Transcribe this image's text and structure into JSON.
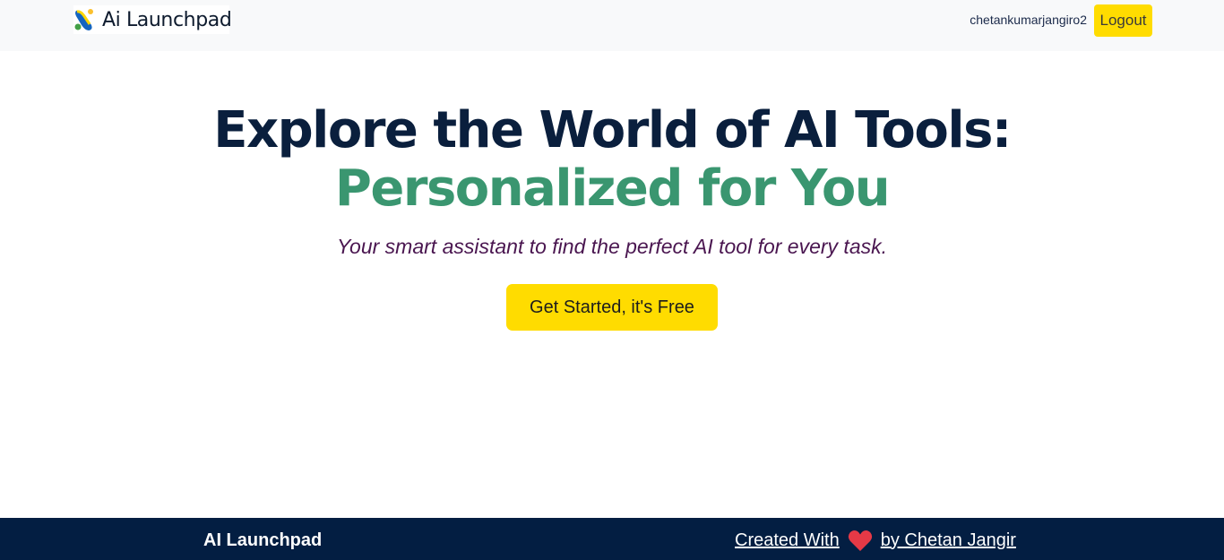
{
  "header": {
    "brand_text": "Ai Launchpad",
    "username": "chetankumarjangiro2",
    "logout_label": "Logout"
  },
  "hero": {
    "title_line1": "Explore the World of AI Tools:",
    "title_line2": "Personalized for You",
    "tagline": "Your smart assistant to find the perfect AI tool for every task.",
    "cta_label": "Get Started, it's Free"
  },
  "footer": {
    "brand": "AI Launchpad",
    "created_with": "Created With",
    "by_author": "by Chetan Jangir",
    "heart_icon": "heart-icon"
  },
  "colors": {
    "accent_yellow": "#ffdc00",
    "title_navy": "#0a1f3d",
    "title_green": "#3a9670",
    "tagline_purple": "#4a1650",
    "footer_bg": "#031e42",
    "heart_red": "#e63946"
  }
}
